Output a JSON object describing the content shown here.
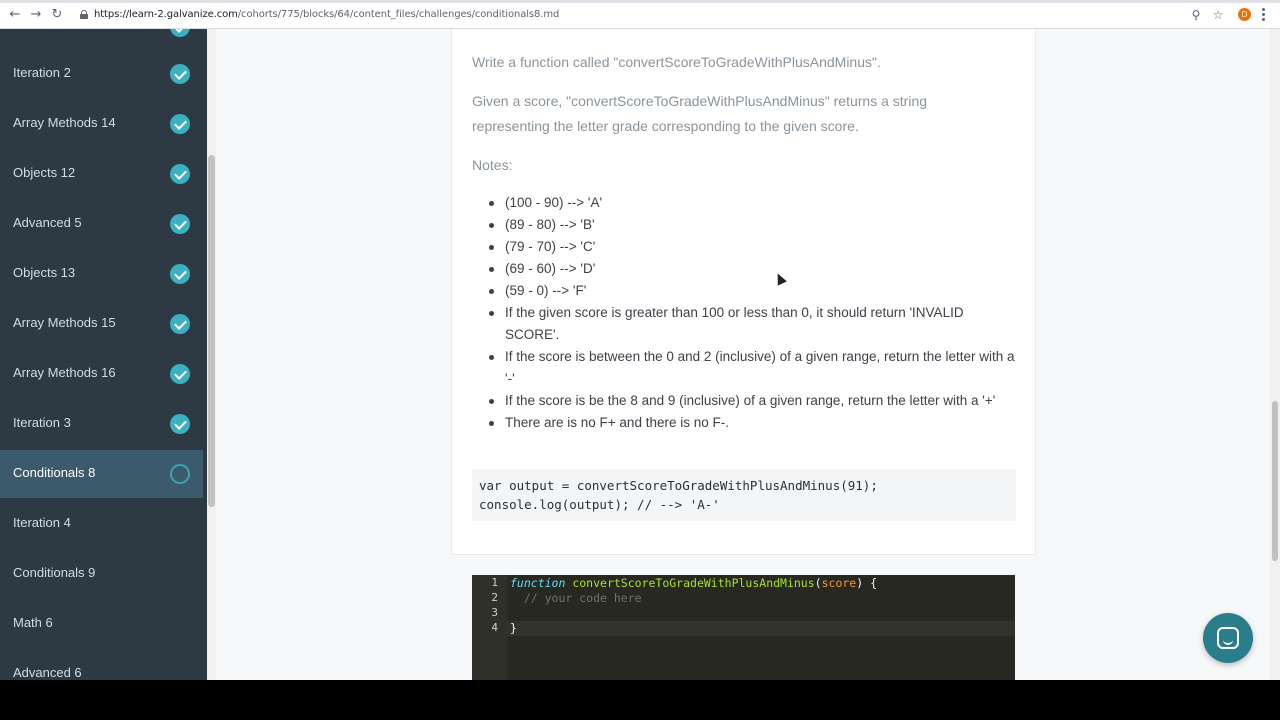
{
  "browser": {
    "url_host": "https://learn-2.galvanize.com",
    "url_path": "/cohorts/775/blocks/64/content_files/challenges/conditionals8.md",
    "back_icon": "back-arrow-icon",
    "forward_icon": "forward-arrow-icon",
    "reload_icon": "reload-icon",
    "avatar_letter": "D"
  },
  "sidebar": {
    "items": [
      {
        "label": "Iteration 2",
        "status": "complete"
      },
      {
        "label": "Array Methods 14",
        "status": "complete"
      },
      {
        "label": "Objects 12",
        "status": "complete"
      },
      {
        "label": "Advanced 5",
        "status": "complete"
      },
      {
        "label": "Objects 13",
        "status": "complete"
      },
      {
        "label": "Array Methods 15",
        "status": "complete"
      },
      {
        "label": "Array Methods 16",
        "status": "complete"
      },
      {
        "label": "Iteration 3",
        "status": "complete"
      },
      {
        "label": "Conditionals 8",
        "status": "in-progress"
      },
      {
        "label": "Iteration 4",
        "status": "none"
      },
      {
        "label": "Conditionals 9",
        "status": "none"
      },
      {
        "label": "Math 6",
        "status": "none"
      },
      {
        "label": "Advanced 6",
        "status": "none"
      }
    ],
    "accent_color": "#3ab0c1"
  },
  "challenge": {
    "intro": "Write a function called \"convertScoreToGradeWithPlusAndMinus\".",
    "description_line1": "Given a score, \"convertScoreToGradeWithPlusAndMinus\" returns a string",
    "description_line2": "representing the letter grade corresponding to the given score.",
    "notes_label": "Notes:",
    "notes": [
      "(100 - 90) --> 'A'",
      "(89 - 80) --> 'B'",
      "(79 - 70) --> 'C'",
      "(69 - 60) --> 'D'",
      "(59 - 0) --> 'F'",
      "If the given score is greater than 100 or less than 0, it should return 'INVALID SCORE'.",
      "If the score is between the 0 and 2 (inclusive) of a given range, return the letter with a '-'",
      "If the score is be the 8 and 9 (inclusive) of a given range, return the letter with a '+'",
      "There are is no F+ and there is no F-."
    ],
    "example_line1": "var output = convertScoreToGradeWithPlusAndMinus(91);",
    "example_line2": "console.log(output); // --> 'A-'"
  },
  "editor": {
    "line_numbers": [
      "1",
      "2",
      "3",
      "4"
    ],
    "line1_keyword": "function",
    "line1_name": "convertScoreToGradeWithPlusAndMinus",
    "line1_open": "(",
    "line1_param": "score",
    "line1_close": ") {",
    "line2_comment": "// your code here",
    "line4": "}"
  }
}
